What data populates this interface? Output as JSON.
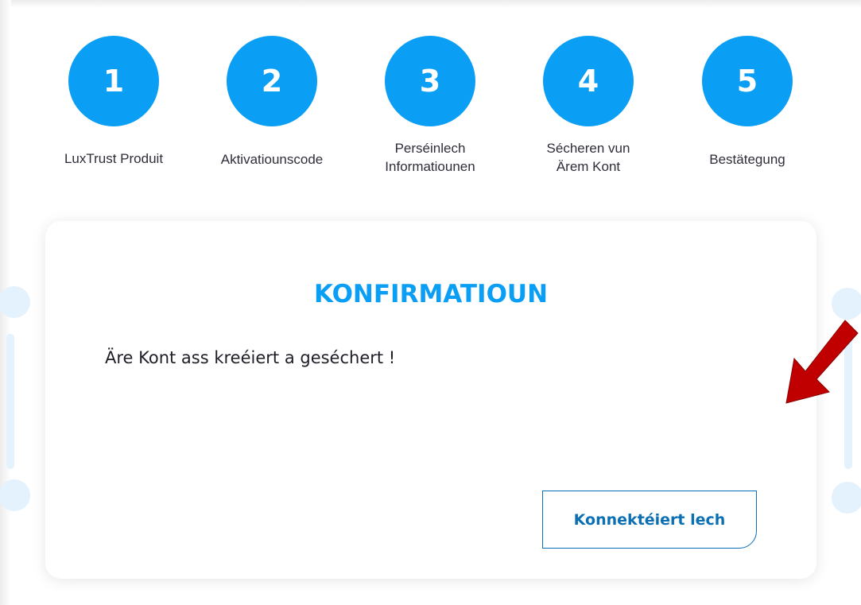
{
  "stepper": {
    "steps": [
      {
        "number": "1",
        "label_line1": "LuxTrust Produit",
        "label_line2": ""
      },
      {
        "number": "2",
        "label_line1": "Aktivatiounscode",
        "label_line2": ""
      },
      {
        "number": "3",
        "label_line1": "Perséinlech",
        "label_line2": "Informatiounen"
      },
      {
        "number": "4",
        "label_line1": "Sécheren vun",
        "label_line2": "Ärem Kont"
      },
      {
        "number": "5",
        "label_line1": "Bestätegung",
        "label_line2": ""
      }
    ]
  },
  "card": {
    "title": "KONFIRMATIOUN",
    "message": "Äre Kont ass kreéiert a geséchert !",
    "connect_label": "Konnektéiert lech"
  },
  "colors": {
    "accent": "#0b9ef5",
    "button_border": "#0b6fb3",
    "arrow": "#c00000"
  },
  "icons": {
    "annotation_arrow": "red-arrow-icon"
  }
}
